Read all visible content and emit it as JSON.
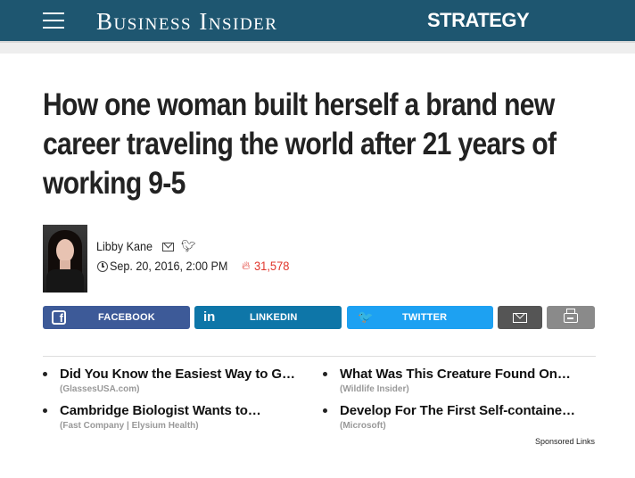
{
  "header": {
    "brand": "Business Insider",
    "section": "STRATEGY",
    "colors": {
      "bar": "#1e5670",
      "subbar": "#eeeeee"
    },
    "menu_icon": "hamburger-icon"
  },
  "article": {
    "headline": "How one woman built herself a brand new career traveling the world after 21 years of working 9-5",
    "author": "Libby Kane",
    "date": "Sep. 20, 2016, 2:00 PM",
    "views": "31,578",
    "icons": [
      "mail-icon",
      "twitter-icon",
      "clock-icon",
      "fire-icon"
    ],
    "accent_color": "#e0352b"
  },
  "share": {
    "facebook": "FACEBOOK",
    "linkedin": "LINKEDIN",
    "twitter": "TWITTER",
    "colors": {
      "facebook": "#3d5a98",
      "linkedin": "#0e76a8",
      "twitter": "#1da1f2",
      "email": "#555555",
      "print": "#8a8a8a"
    },
    "linkedin_icon_text": "in",
    "facebook_icon_text": "f",
    "twitter_icon_text": "🐦"
  },
  "sponsored": {
    "items": [
      {
        "title": "Did You Know the Easiest Way to G…",
        "source": "(GlassesUSA.com)"
      },
      {
        "title": "What Was This Creature Found On…",
        "source": "(Wildlife Insider)"
      },
      {
        "title": "Cambridge Biologist Wants to…",
        "source": "(Fast Company | Elysium Health)"
      },
      {
        "title": "Develop For The First Self-containe…",
        "source": "(Microsoft)"
      }
    ],
    "label": "Sponsored Links"
  }
}
